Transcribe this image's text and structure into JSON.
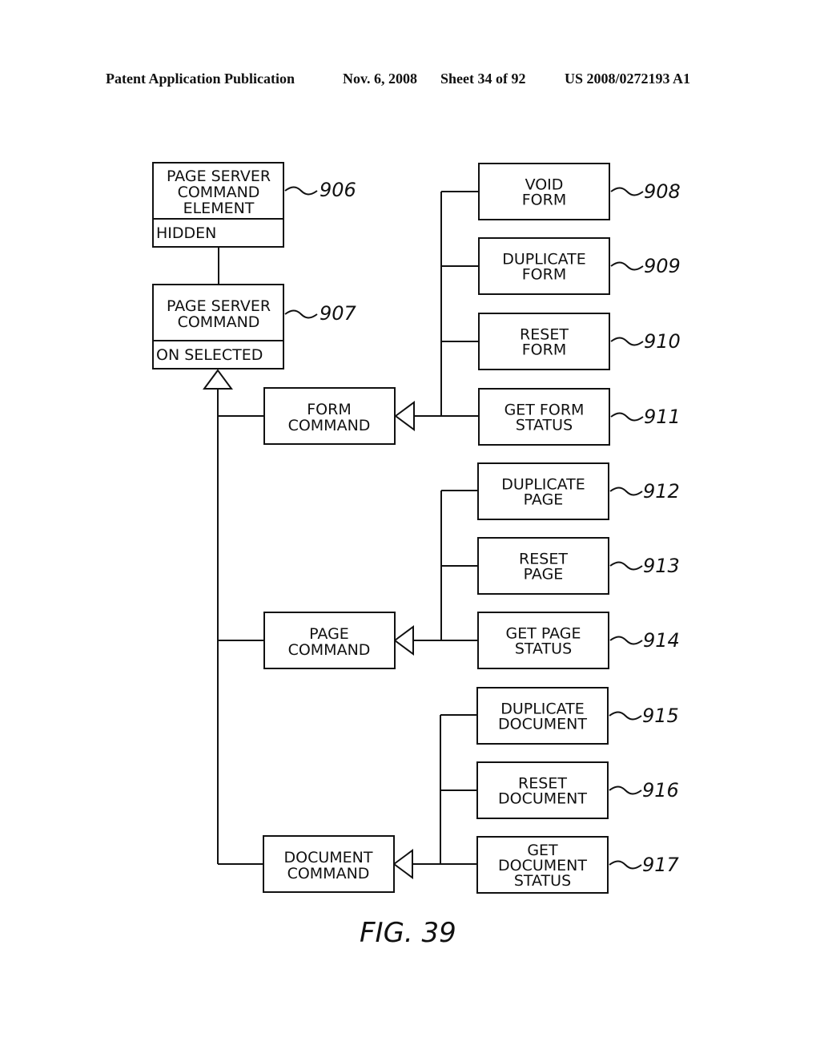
{
  "header": {
    "publication": "Patent Application Publication",
    "date": "Nov. 6, 2008",
    "sheet": "Sheet 34 of 92",
    "patent_number": "US 2008/0272193 A1"
  },
  "figure_label": "FIG. 39",
  "classes": {
    "page_server_command_element": {
      "lines": [
        "PAGE SERVER",
        "COMMAND",
        "ELEMENT"
      ],
      "attribute": "HIDDEN",
      "ref": "906"
    },
    "page_server_command": {
      "lines": [
        "PAGE SERVER",
        "COMMAND"
      ],
      "attribute": "ON SELECTED",
      "ref": "907"
    },
    "form_command": {
      "lines": [
        "FORM",
        "COMMAND"
      ]
    },
    "page_command": {
      "lines": [
        "PAGE",
        "COMMAND"
      ]
    },
    "document_command": {
      "lines": [
        "DOCUMENT",
        "COMMAND"
      ]
    }
  },
  "subclasses": [
    {
      "lines": [
        "VOID",
        "FORM"
      ],
      "ref": "908",
      "parent": "form_command"
    },
    {
      "lines": [
        "DUPLICATE",
        "FORM"
      ],
      "ref": "909",
      "parent": "form_command"
    },
    {
      "lines": [
        "RESET",
        "FORM"
      ],
      "ref": "910",
      "parent": "form_command"
    },
    {
      "lines": [
        "GET FORM",
        "STATUS"
      ],
      "ref": "911",
      "parent": "form_command"
    },
    {
      "lines": [
        "DUPLICATE",
        "PAGE"
      ],
      "ref": "912",
      "parent": "page_command"
    },
    {
      "lines": [
        "RESET",
        "PAGE"
      ],
      "ref": "913",
      "parent": "page_command"
    },
    {
      "lines": [
        "GET PAGE",
        "STATUS"
      ],
      "ref": "914",
      "parent": "page_command"
    },
    {
      "lines": [
        "DUPLICATE",
        "DOCUMENT"
      ],
      "ref": "915",
      "parent": "document_command"
    },
    {
      "lines": [
        "RESET",
        "DOCUMENT"
      ],
      "ref": "916",
      "parent": "document_command"
    },
    {
      "lines": [
        "GET",
        "DOCUMENT",
        "STATUS"
      ],
      "ref": "917",
      "parent": "document_command"
    }
  ]
}
